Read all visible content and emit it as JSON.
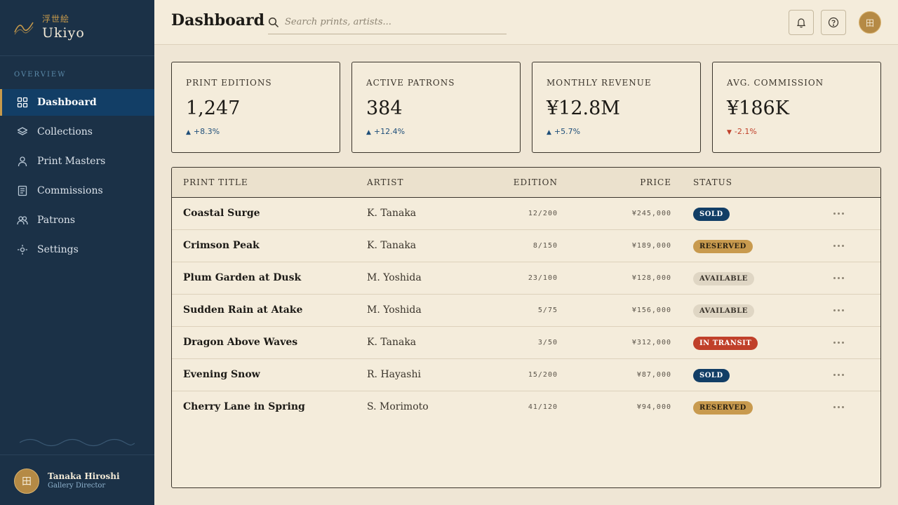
{
  "brand": {
    "kanji": "浮世絵",
    "name": "Ukiyo"
  },
  "sidebar": {
    "section_label": "OVERVIEW",
    "items": [
      {
        "label": "Dashboard",
        "icon": "grid-icon",
        "active": true
      },
      {
        "label": "Collections",
        "icon": "layers-icon",
        "active": false
      },
      {
        "label": "Print Masters",
        "icon": "person-icon",
        "active": false
      },
      {
        "label": "Commissions",
        "icon": "document-icon",
        "active": false
      },
      {
        "label": "Patrons",
        "icon": "people-icon",
        "active": false
      },
      {
        "label": "Settings",
        "icon": "settings-icon",
        "active": false
      }
    ]
  },
  "user": {
    "name": "Tanaka Hiroshi",
    "role": "Gallery Director",
    "avatar_glyph": "田"
  },
  "header": {
    "title": "Dashboard",
    "search_placeholder": "Search prints, artists...",
    "avatar_glyph": "田"
  },
  "stats": [
    {
      "label": "PRINT EDITIONS",
      "value": "1,247",
      "trend": "+8.3%",
      "direction": "up"
    },
    {
      "label": "ACTIVE PATRONS",
      "value": "384",
      "trend": "+12.4%",
      "direction": "up"
    },
    {
      "label": "MONTHLY REVENUE",
      "value": "¥12.8M",
      "trend": "+5.7%",
      "direction": "up"
    },
    {
      "label": "AVG. COMMISSION",
      "value": "¥186K",
      "trend": "-2.1%",
      "direction": "down"
    }
  ],
  "table": {
    "columns": [
      "PRINT TITLE",
      "ARTIST",
      "EDITION",
      "PRICE",
      "STATUS"
    ],
    "rows": [
      {
        "title": "Coastal Surge",
        "artist": "K. Tanaka",
        "edition": "12/200",
        "price": "¥245,000",
        "status": "SOLD"
      },
      {
        "title": "Crimson Peak",
        "artist": "K. Tanaka",
        "edition": "8/150",
        "price": "¥189,000",
        "status": "RESERVED"
      },
      {
        "title": "Plum Garden at Dusk",
        "artist": "M. Yoshida",
        "edition": "23/100",
        "price": "¥128,000",
        "status": "AVAILABLE"
      },
      {
        "title": "Sudden Rain at Atake",
        "artist": "M. Yoshida",
        "edition": "5/75",
        "price": "¥156,000",
        "status": "AVAILABLE"
      },
      {
        "title": "Dragon Above Waves",
        "artist": "K. Tanaka",
        "edition": "3/50",
        "price": "¥312,000",
        "status": "IN TRANSIT"
      },
      {
        "title": "Evening Snow",
        "artist": "R. Hayashi",
        "edition": "15/200",
        "price": "¥87,000",
        "status": "SOLD"
      },
      {
        "title": "Cherry Lane in Spring",
        "artist": "S. Morimoto",
        "edition": "41/120",
        "price": "¥94,000",
        "status": "RESERVED"
      }
    ]
  },
  "colors": {
    "sidebar_bg": "#1b3147",
    "accent_gold": "#c79a4b",
    "navy": "#123e66",
    "vermilion": "#c0402a",
    "paper": "#f4ecdb"
  }
}
